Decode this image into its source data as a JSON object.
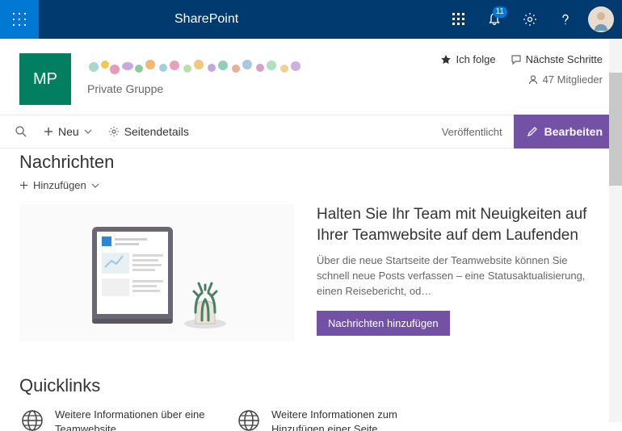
{
  "suite": {
    "app_name": "SharePoint",
    "notification_count": "11"
  },
  "site": {
    "logo_initials": "MP",
    "description": "Private Gruppe",
    "follow_label": "Ich folge",
    "next_steps_label": "Nächste Schritte",
    "members_label": "47 Mitglieder"
  },
  "commandbar": {
    "new_label": "Neu",
    "page_details_label": "Seitendetails",
    "status": "Veröffentlicht",
    "edit_label": "Bearbeiten"
  },
  "news": {
    "section_title": "Nachrichten",
    "add_label": "Hinzufügen",
    "heading": "Halten Sie Ihr Team mit Neuigkeiten auf Ihrer Teamwebsite auf dem Laufenden",
    "description": "Über die neue Startseite der Teamwebsite können Sie schnell neue Posts verfassen – eine Statusaktualisierung, einen Reisebericht, od…",
    "button_label": "Nachrichten hinzufügen"
  },
  "quicklinks": {
    "section_title": "Quicklinks",
    "items": [
      {
        "label": "Weitere Informationen über eine Teamwebsite"
      },
      {
        "label": "Weitere Informationen zum Hinzufügen einer Seite"
      }
    ]
  }
}
